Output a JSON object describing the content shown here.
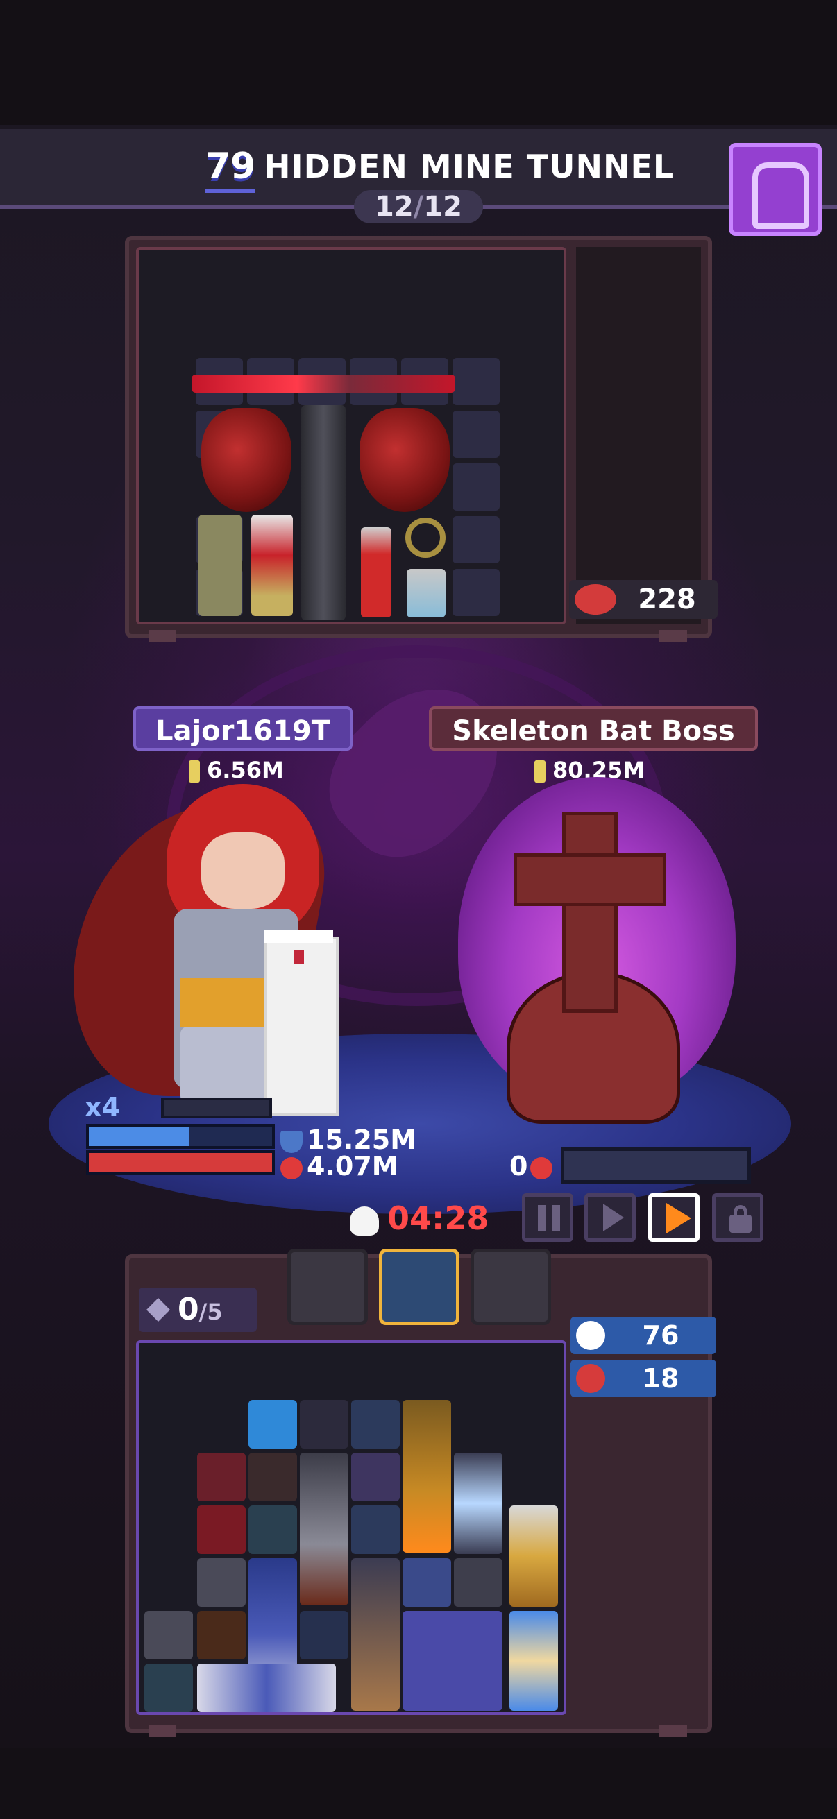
{
  "header": {
    "level": "79",
    "stage_title": "HIDDEN MINE TUNNEL",
    "wave_current": "12",
    "wave_separator": "/",
    "wave_total": "12"
  },
  "enemy_panel": {
    "hp_value": "228"
  },
  "player": {
    "name": "Lajor1619T",
    "power": "6.56M",
    "multiplier": "x4",
    "shield": "15.25M",
    "health": "4.07M",
    "shield_fraction": 0.55,
    "health_fraction": 1.0
  },
  "boss": {
    "name": "Skeleton Bat Boss",
    "power": "80.25M",
    "health": "0",
    "health_fraction": 0.0
  },
  "battle": {
    "timer": "04:28",
    "speed_options": [
      "pause",
      "normal",
      "fast",
      "locked"
    ],
    "selected_speed": "fast"
  },
  "inventory": {
    "slots_used": "0",
    "slots_total": "/5",
    "kills_stat": "76",
    "souls_stat": "18"
  },
  "colors": {
    "accent_purple": "#9440d0",
    "player_plate": "#5a3ea0",
    "boss_plate": "#5b2c3a",
    "timer_red": "#ff4a4a",
    "fast_forward_orange": "#ff8a1c",
    "side_stat_blue": "#2d5aa8"
  },
  "icons": {
    "backpack": "backpack-icon",
    "sword": "sword-icon",
    "shield": "shield-icon",
    "heart": "heart-icon",
    "skull": "skull-icon",
    "lock": "lock-icon",
    "crossed_swords": "crossed-swords-icon",
    "demon": "demon-face-icon"
  }
}
